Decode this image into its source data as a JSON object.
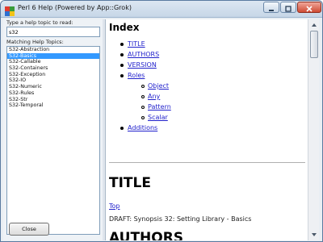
{
  "window": {
    "title": "Perl 6 Help (Powered by App::Grok)"
  },
  "left_pane": {
    "search_label": "Type a help topic to read:",
    "search_value": "s32",
    "matching_label": "Matching Help Topics:",
    "topics": [
      "S32-Abstraction",
      "S32-Basics",
      "S32-Callable",
      "S32-Containers",
      "S32-Exception",
      "S32-IO",
      "S32-Numeric",
      "S32-Rules",
      "S32-Str",
      "S32-Temporal"
    ],
    "selected_topic": "S32-Basics",
    "close_label": "Close"
  },
  "content": {
    "index_heading": "Index",
    "index_items": [
      {
        "label": "TITLE",
        "level": 1
      },
      {
        "label": "AUTHORS",
        "level": 1
      },
      {
        "label": "VERSION",
        "level": 1
      },
      {
        "label": "Roles",
        "level": 1
      },
      {
        "label": "Object",
        "level": 2
      },
      {
        "label": "Any",
        "level": 2
      },
      {
        "label": "Pattern",
        "level": 2
      },
      {
        "label": "Scalar",
        "level": 2
      },
      {
        "label": "Additions",
        "level": 1
      }
    ],
    "title_heading": "TITLE",
    "top_link": "Top",
    "draft_text": "DRAFT: Synopsis 32: Setting Library - Basics",
    "authors_heading": "AUTHORS"
  },
  "icons": {
    "app": "app-icon",
    "minimize": "minimize-icon",
    "maximize": "maximize-icon",
    "close": "close-icon",
    "scroll_up": "scroll-up-icon",
    "scroll_down": "scroll-down-icon"
  },
  "colors": {
    "selection": "#3399ff",
    "link": "#2222cc",
    "close_button": "#cf4b34"
  }
}
